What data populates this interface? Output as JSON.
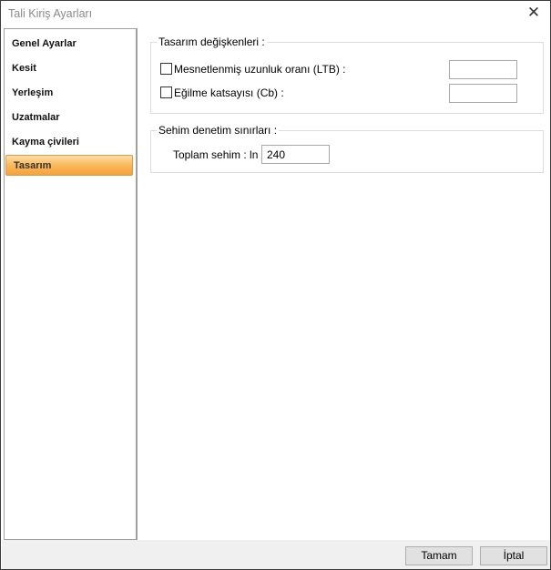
{
  "window": {
    "title": "Tali Kiriş Ayarları",
    "close_icon": "close-icon"
  },
  "sidebar": {
    "items": [
      {
        "label": "Genel Ayarlar"
      },
      {
        "label": "Kesit"
      },
      {
        "label": "Yerleşim"
      },
      {
        "label": "Uzatmalar"
      },
      {
        "label": "Kayma çivileri"
      },
      {
        "label": "Tasarım",
        "selected": true
      }
    ]
  },
  "design_vars": {
    "title": "Tasarım değişkenleri :",
    "ltb_label": "Mesnetlenmiş uzunluk oranı (LTB) :",
    "ltb_checked": false,
    "ltb_value": "",
    "cb_label": "Eğilme katsayısı (Cb) :",
    "cb_checked": false,
    "cb_value": ""
  },
  "deflection": {
    "title": "Sehim denetim sınırları :",
    "total_label": "Toplam sehim : ln /",
    "total_value": "240"
  },
  "buttons": {
    "ok": "Tamam",
    "cancel": "İptal"
  },
  "colors": {
    "selected": "#f9b85a"
  }
}
